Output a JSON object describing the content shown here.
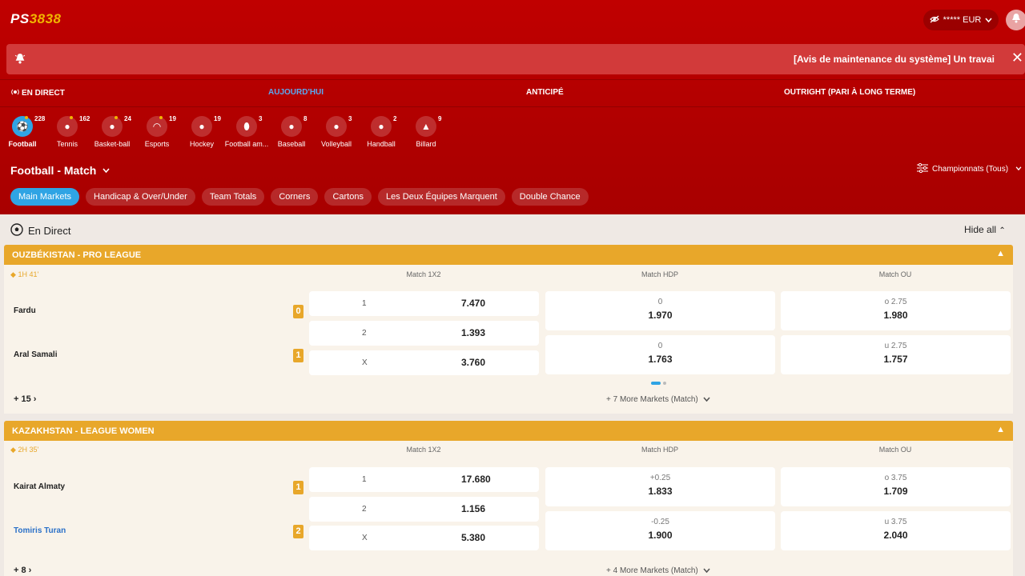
{
  "header": {
    "logo_left": "PS",
    "logo_right": "3838",
    "balance": "***** EUR",
    "notice": "[Avis de maintenance du système] Un travai"
  },
  "nav_tabs": [
    {
      "label": "EN DIRECT"
    },
    {
      "label": "AUJOURD'HUI"
    },
    {
      "label": "ANTICIPÉ"
    },
    {
      "label": "OUTRIGHT (PARI À LONG TERME)"
    }
  ],
  "sports": [
    {
      "label": "Football",
      "count": "228"
    },
    {
      "label": "Tennis",
      "count": "162"
    },
    {
      "label": "Basket-ball",
      "count": "24"
    },
    {
      "label": "Esports",
      "count": "19"
    },
    {
      "label": "Hockey",
      "count": "19"
    },
    {
      "label": "Football am...",
      "count": "3"
    },
    {
      "label": "Baseball",
      "count": "8"
    },
    {
      "label": "Volleyball",
      "count": "3"
    },
    {
      "label": "Handball",
      "count": "2"
    },
    {
      "label": "Billard",
      "count": "9"
    }
  ],
  "market": {
    "title": "Football - Match",
    "championships": "Championnats (Tous)"
  },
  "chips": [
    {
      "label": "Main Markets"
    },
    {
      "label": "Handicap & Over/Under"
    },
    {
      "label": "Team Totals"
    },
    {
      "label": "Corners"
    },
    {
      "label": "Cartons"
    },
    {
      "label": "Les Deux Équipes Marquent"
    },
    {
      "label": "Double Chance"
    }
  ],
  "section": {
    "title": "En Direct",
    "hide_all": "Hide all"
  },
  "columns": {
    "c1": "Match 1X2",
    "c2": "Match HDP",
    "c3": "Match OU"
  },
  "matches": [
    {
      "league": "OUZBÉKISTAN - PRO LEAGUE",
      "time": "1H 41'",
      "home": "Fardu",
      "home_score": "0",
      "away": "Aral Samali",
      "away_score": "1",
      "x12": [
        {
          "k": "1",
          "v": "7.470"
        },
        {
          "k": "2",
          "v": "1.393"
        },
        {
          "k": "X",
          "v": "3.760"
        }
      ],
      "hdp": [
        {
          "k": "0",
          "v": "1.970"
        },
        {
          "k": "0",
          "v": "1.763"
        }
      ],
      "ou": [
        {
          "k": "o 2.75",
          "v": "1.980"
        },
        {
          "k": "u 2.75",
          "v": "1.757"
        }
      ],
      "more": "+ 15",
      "more_markets": "+ 7 More Markets (Match)"
    },
    {
      "league": "KAZAKHSTAN - LEAGUE WOMEN",
      "time": "2H 35'",
      "home": "Kairat Almaty",
      "home_score": "1",
      "away": "Tomiris Turan",
      "away_score": "2",
      "x12": [
        {
          "k": "1",
          "v": "17.680"
        },
        {
          "k": "2",
          "v": "1.156"
        },
        {
          "k": "X",
          "v": "5.380"
        }
      ],
      "hdp": [
        {
          "k": "+0.25",
          "v": "1.833"
        },
        {
          "k": "-0.25",
          "v": "1.900"
        }
      ],
      "ou": [
        {
          "k": "o 3.75",
          "v": "1.709"
        },
        {
          "k": "u 3.75",
          "v": "2.040"
        }
      ],
      "more": "+ 8",
      "more_markets": "+ 4 More Markets (Match)"
    }
  ],
  "colors": {
    "brand_red": "#b00000",
    "accent_blue": "#2fa4e4",
    "league_gold": "#e8a72a"
  }
}
